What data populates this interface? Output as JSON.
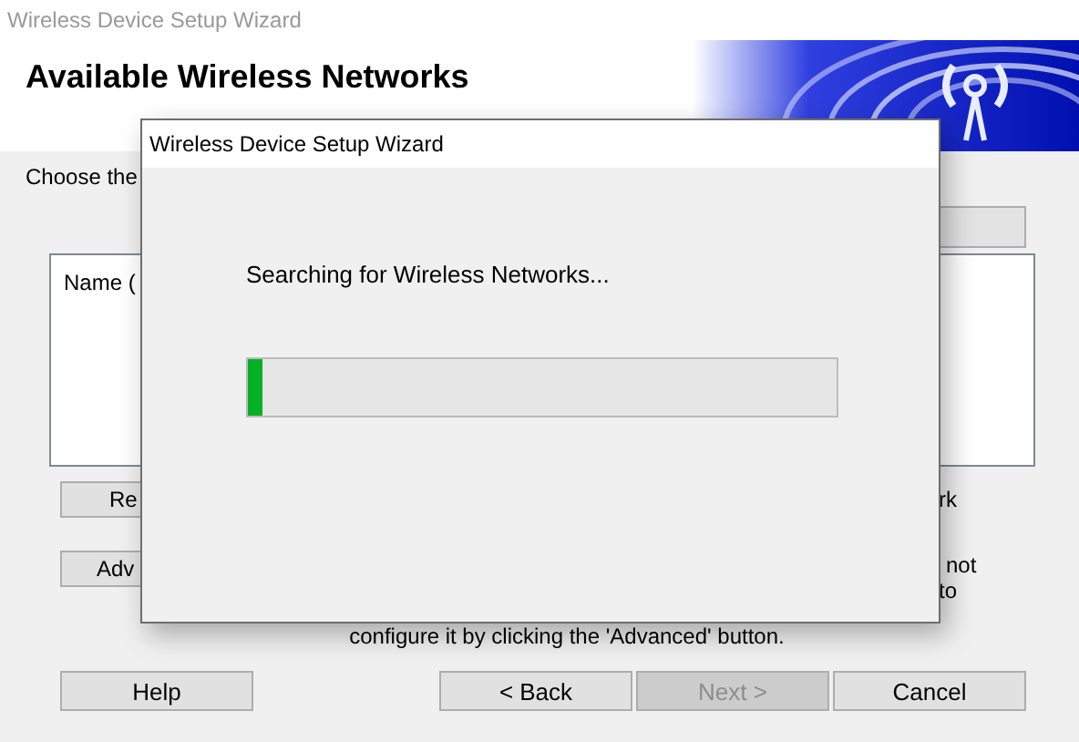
{
  "background_window": {
    "title": "Wireless Device Setup Wizard",
    "heading": "Available Wireless Networks",
    "instruction": "Choose the",
    "network_list": {
      "column_header": "Name ("
    },
    "side_buttons": [
      {
        "label": "Re"
      },
      {
        "label": "Adv"
      }
    ],
    "right_texts": [
      "rk",
      "not",
      "to"
    ],
    "note": "configure it by clicking the 'Advanced' button.",
    "footer_buttons": [
      {
        "label": "Help",
        "disabled": false
      },
      {
        "label": "< Back",
        "disabled": false
      },
      {
        "label": "Next >",
        "disabled": true
      },
      {
        "label": "Cancel",
        "disabled": false
      }
    ]
  },
  "dialog": {
    "title": "Wireless Device Setup Wizard",
    "message": "Searching for Wireless Networks...",
    "progress": {
      "level": 0.025
    }
  }
}
